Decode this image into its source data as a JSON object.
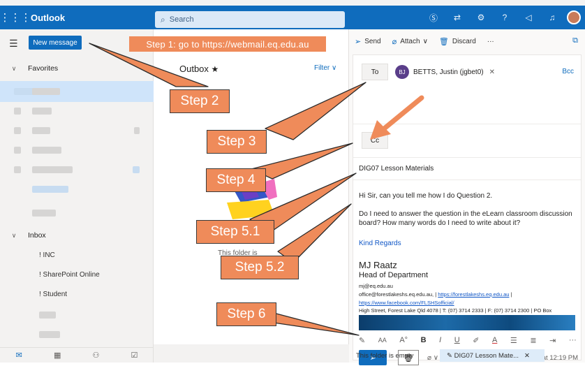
{
  "app": {
    "name": "Outlook"
  },
  "search": {
    "placeholder": "Search"
  },
  "nav": {
    "new_message": "New message",
    "favorites": "Favorites",
    "inbox": "Inbox",
    "folders": [
      "! INC",
      "! SharePoint Online",
      "! Student"
    ]
  },
  "list": {
    "title": "Outbox",
    "filter": "Filter",
    "empty_text": "This folder is",
    "footer": "This folder is empty"
  },
  "compose": {
    "toolbar": {
      "send": "Send",
      "attach": "Attach",
      "discard": "Discard",
      "more": "···"
    },
    "to_label": "To",
    "cc_label": "Cc",
    "bcc_label": "Bcc",
    "recipient": {
      "initials": "BJ",
      "name": "BETTS, Justin (jgbet0)"
    },
    "subject": "DIG07 Lesson Materials",
    "body": {
      "line1": "Hi Sir, can you tell me how I do Question 2.",
      "line2": "Do I need to answer the question in the eLearn classroom discussion board? How many words do I need to write about it?",
      "closing": "Kind Regards"
    },
    "signature": {
      "name": "MJ Raatz",
      "title": "Head of Department",
      "email": "mj@eq.edu.au",
      "office_email": "office@forestlakeshs.eq.edu.au,",
      "site": "https://forestlakeshs.eq.edu.au",
      "facebook": "https://www.facebook.com/FLSHSofficial/",
      "address": "High Street, Forest Lake Qld 4078  |  T: (07) 3714 2333  |  F: (07) 3714 2300  |  PO Box"
    },
    "draft_status": "Draft saved at 12:19 PM",
    "draft_tab": "DIG07 Lesson Mate..."
  },
  "steps": {
    "s1": "Step 1: go to https://webmail.eq.edu.au",
    "s2": "Step 2",
    "s3": "Step 3",
    "s4": "Step 4",
    "s51": "Step 5.1",
    "s52": "Step 5.2",
    "s6": "Step 6"
  },
  "colors": {
    "brand": "#0f6cbd",
    "annotation": "#ef8b5a"
  }
}
